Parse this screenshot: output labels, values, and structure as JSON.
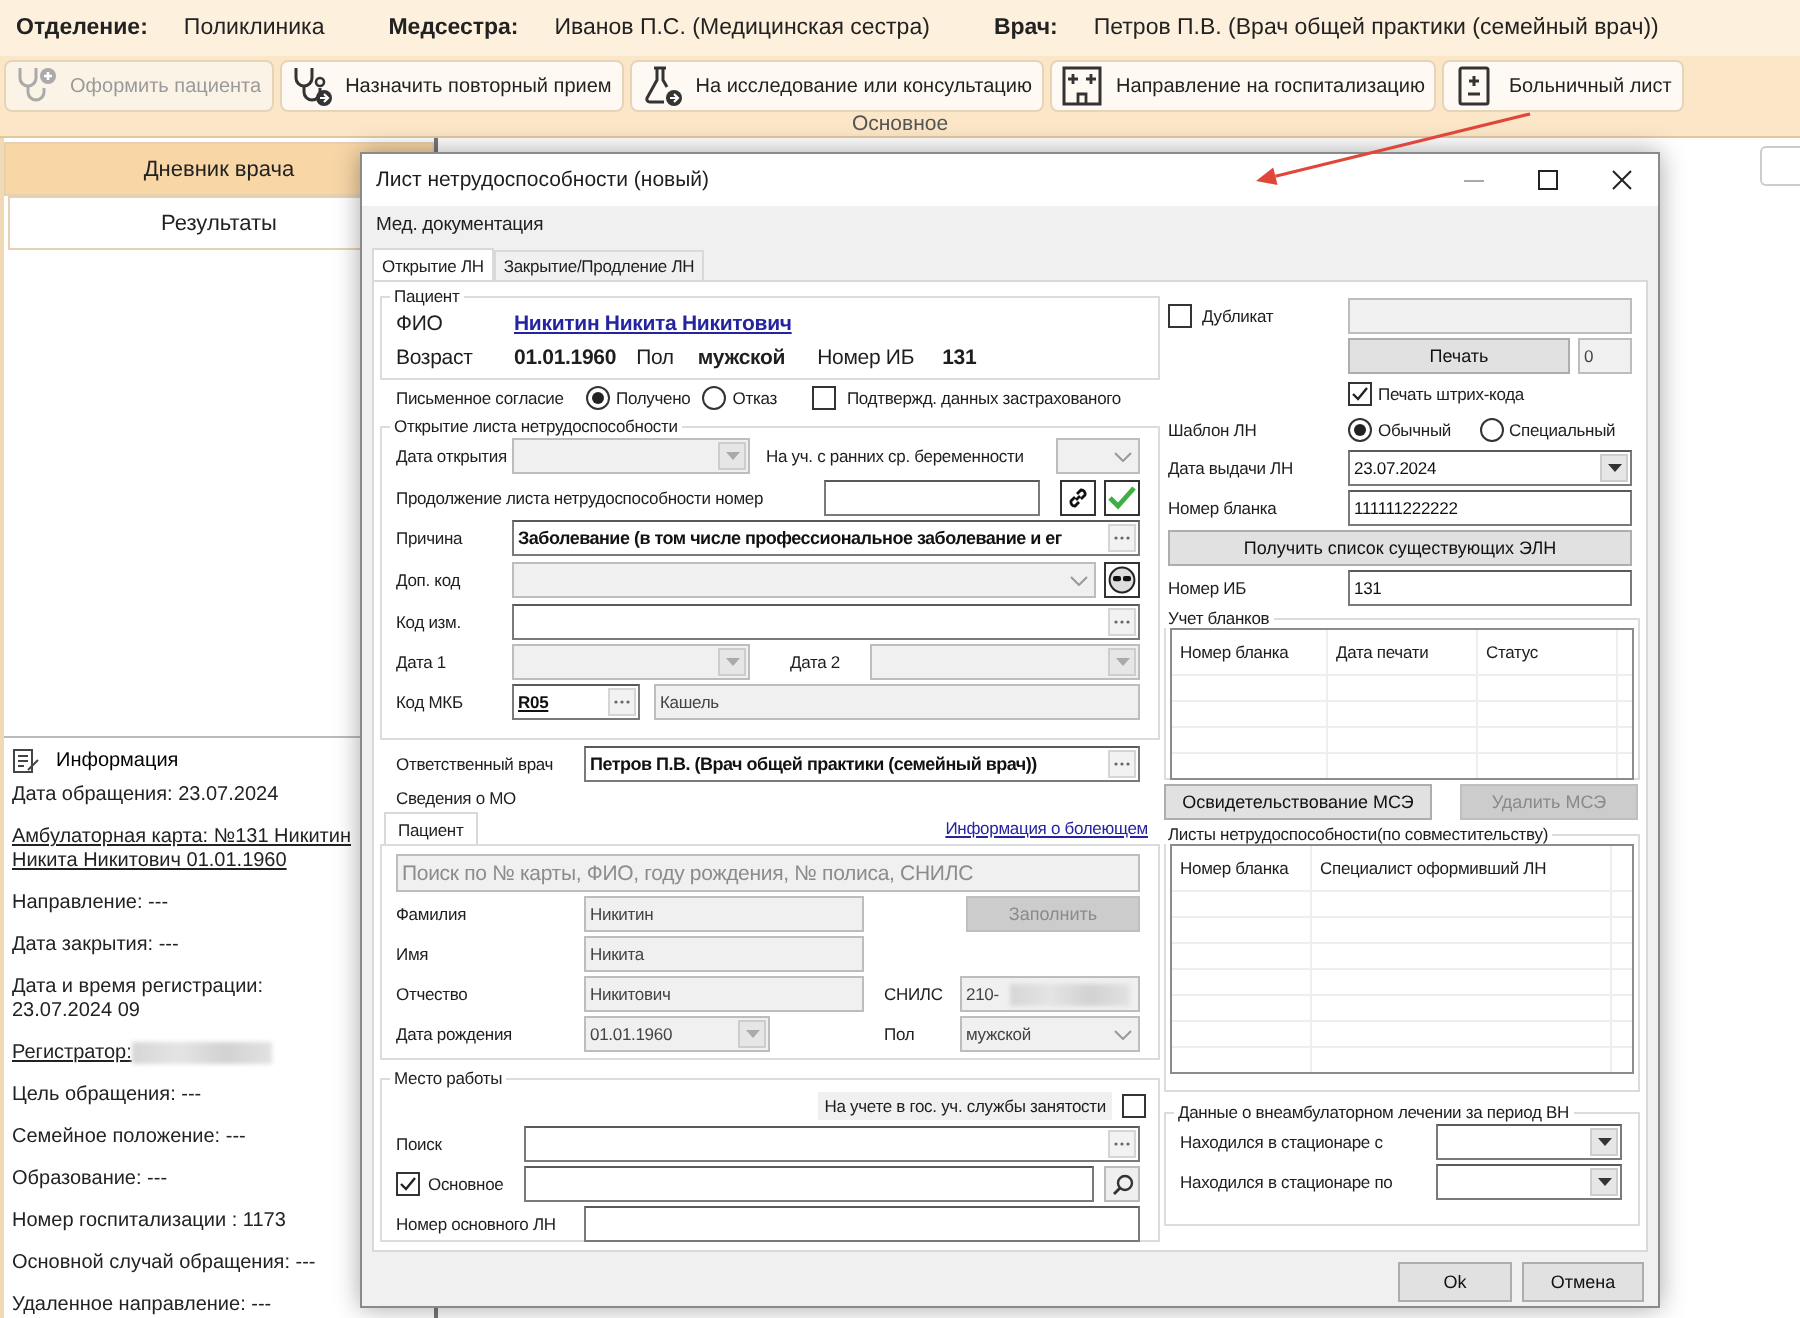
{
  "header": [
    {
      "label": "Отделение:",
      "value": "Поликлиника"
    },
    {
      "label": "Медсестра:",
      "value": "Иванов П.С. (Медицинская сестра)"
    },
    {
      "label": "Врач:",
      "value": "Петров П.В. (Врач общей практики (семейный врач))"
    }
  ],
  "toolbar": {
    "buttons": [
      {
        "label": "Оформить пациента",
        "disabled": true
      },
      {
        "label": "Назначить повторный прием",
        "disabled": false
      },
      {
        "label": "На исследование или консультацию",
        "disabled": false
      },
      {
        "label": "Направление на госпитализацию",
        "disabled": false
      },
      {
        "label": "Больничный лист",
        "disabled": false
      }
    ],
    "group": "Основное"
  },
  "sidebar": {
    "tabs": [
      {
        "label": "Дневник врача",
        "selected": true
      },
      {
        "label": "Результаты",
        "selected": false
      }
    ],
    "info": {
      "title": "Информация",
      "lines": [
        {
          "kind": "text",
          "text": "Дата обращения: 23.07.2024"
        },
        {
          "kind": "link",
          "text": "Амбулаторная карта: №131 Никитин Никита Никитович 01.01.1960"
        },
        {
          "kind": "text",
          "text": "Направление: ---"
        },
        {
          "kind": "text",
          "text": "Дата закрытия: ---"
        },
        {
          "kind": "text",
          "text": "Дата и время регистрации: 23.07.2024 09"
        },
        {
          "kind": "link",
          "text": "Регистратор:",
          "redacted": true
        },
        {
          "kind": "text",
          "text": "Цель обращения: ---"
        },
        {
          "kind": "text",
          "text": "Семейное положение: ---"
        },
        {
          "kind": "text",
          "text": "Образование: ---"
        },
        {
          "kind": "text",
          "text": "Номер госпитализации : 1173"
        },
        {
          "kind": "text",
          "text": "Основной случай обращения: ---"
        },
        {
          "kind": "text",
          "text": "Удаленное направление: ---"
        }
      ]
    }
  },
  "dialog": {
    "title": "Лист нетрудоспособности (новый)",
    "menu": [
      "Мед. документация"
    ],
    "tabs": [
      {
        "label": "Открытие ЛН",
        "selected": true
      },
      {
        "label": "Закрытие/Продление ЛН",
        "selected": false
      }
    ],
    "patient": {
      "title": "Пациент",
      "fio_label": "ФИО",
      "fio": "Никитин Никита Никитович",
      "age_label": "Возраст",
      "birth_date": "01.01.1960",
      "sex_label": "Пол",
      "sex": "мужской",
      "ib_label": "Номер ИБ",
      "ib": "131"
    },
    "consent": {
      "label": "Письменное согласие",
      "options": [
        {
          "label": "Получено",
          "selected": true
        },
        {
          "label": "Отказ",
          "selected": false
        }
      ],
      "confirmation": {
        "label": "Подтвержд. данных застрахованого",
        "checked": false
      }
    },
    "opening": {
      "title": "Открытие листа нетрудоспособности",
      "open_date": {
        "label": "Дата открытия",
        "field": {
          "kind": "combo",
          "disabled": true
        }
      },
      "pregnancy": {
        "label": "На уч. с ранних ср. беременности",
        "field": {
          "kind": "select",
          "disabled": true
        }
      },
      "continuation": {
        "label": "Продолжение листа нетрудоспособности номер",
        "field": {
          "kind": "text",
          "disabled": false
        }
      },
      "reason": {
        "label": "Причина",
        "field": {
          "kind": "lookup",
          "value": "Заболевание (в том числе профессиональное заболевание и ег",
          "disabled": false
        }
      },
      "extra_code": {
        "label": "Доп. код",
        "field": {
          "kind": "select",
          "disabled": true
        }
      },
      "change_code": {
        "label": "Код изм.",
        "field": {
          "kind": "lookup",
          "disabled": false
        }
      },
      "date1": {
        "label": "Дата 1",
        "field": {
          "kind": "combo",
          "disabled": true
        }
      },
      "date2": {
        "label": "Дата 2",
        "field": {
          "kind": "combo",
          "disabled": true
        }
      },
      "icd": {
        "label": "Код МКБ",
        "code": {
          "kind": "lookup",
          "value": "R05",
          "disabled": false
        },
        "name": {
          "kind": "text",
          "value": "Кашель",
          "disabled": true
        }
      }
    },
    "doctor": {
      "label": "Ответственный врач",
      "field": {
        "kind": "lookup",
        "value": "Петров П.В. (Врач общей практики (семейный врач))",
        "disabled": false
      }
    },
    "mo_label": "Сведения о МО",
    "patient_tabs": [
      {
        "label": "Пациент",
        "selected": true
      }
    ],
    "sick_info_link": "Информация о болеющем",
    "patient_search": {
      "kind": "text",
      "placeholder": "Поиск по № карты, ФИО, году рождения, № полиса, СНИЛС",
      "disabled": true
    },
    "fill_button": {
      "label": "Заполнить",
      "disabled": true
    },
    "last_name": {
      "label": "Фамилия",
      "field": {
        "kind": "text",
        "value": "Никитин",
        "disabled": true
      }
    },
    "first_name": {
      "label": "Имя",
      "field": {
        "kind": "text",
        "value": "Никита",
        "disabled": true
      }
    },
    "middle_name": {
      "label": "Отчество",
      "field": {
        "kind": "text",
        "value": "Никитович",
        "disabled": true
      }
    },
    "snils": {
      "label": "СНИЛС",
      "field": {
        "kind": "text",
        "value": "210-",
        "disabled": true,
        "redacted": true
      }
    },
    "birth": {
      "label": "Дата рождения",
      "field": {
        "kind": "combo",
        "value": "01.01.1960",
        "disabled": true
      }
    },
    "sex": {
      "label": "Пол",
      "field": {
        "kind": "select",
        "value": "мужской",
        "disabled": true
      }
    },
    "work": {
      "title": "Место работы",
      "employment": {
        "label": "На учете в гос. уч. службы занятости",
        "checked": false
      },
      "search": {
        "label": "Поиск",
        "field": {
          "kind": "lookup",
          "disabled": false
        }
      },
      "main": {
        "label": "Основное",
        "checked": true,
        "field": {
          "kind": "text",
          "disabled": false
        }
      },
      "main_number": {
        "label": "Номер основного ЛН",
        "field": {
          "kind": "text",
          "disabled": false
        }
      }
    },
    "right": {
      "duplicate": {
        "label": "Дубликат",
        "checked": false,
        "field": {
          "kind": "text",
          "disabled": true
        }
      },
      "print_button": {
        "label": "Печать",
        "disabled": false
      },
      "copies": {
        "kind": "text",
        "value": "0",
        "disabled": true
      },
      "barcode": {
        "label": "Печать штрих-кода",
        "checked": true
      },
      "template": {
        "label": "Шаблон ЛН",
        "options": [
          {
            "label": "Обычный",
            "selected": true
          },
          {
            "label": "Специальный",
            "selected": false
          }
        ]
      },
      "issue_date": {
        "label": "Дата выдачи ЛН",
        "field": {
          "kind": "combo",
          "value": "23.07.2024",
          "disabled": false
        }
      },
      "blank_number": {
        "label": "Номер бланка",
        "field": {
          "kind": "text",
          "value": "111111222222",
          "disabled": false
        }
      },
      "get_list_button": {
        "label": "Получить список существующих ЭЛН",
        "disabled": false
      },
      "ib": {
        "label": "Номер ИБ",
        "field": {
          "kind": "text",
          "value": "131",
          "disabled": false
        }
      },
      "blanks": {
        "title": "Учет бланков",
        "columns": [
          "Номер бланка",
          "Дата печати",
          "Статус"
        ]
      },
      "mse_buttons": [
        {
          "label": "Освидетельствование МСЭ",
          "disabled": false
        },
        {
          "label": "Удалить МСЭ",
          "disabled": true
        }
      ],
      "part_time": {
        "title": "Листы нетрудоспособности(по совместительству)",
        "columns": [
          "Номер бланка",
          "Специалист оформивший ЛН"
        ]
      },
      "inpatient": {
        "title": "Данные о внеамбулаторном лечении за период ВН",
        "rows": [
          {
            "label": "Находился в стационаре с",
            "field": {
              "kind": "combo",
              "disabled": false
            }
          },
          {
            "label": "Находился в стационаре по",
            "field": {
              "kind": "combo",
              "disabled": false
            }
          }
        ]
      }
    },
    "buttons": [
      {
        "label": "Ok"
      },
      {
        "label": "Отмена"
      }
    ]
  }
}
